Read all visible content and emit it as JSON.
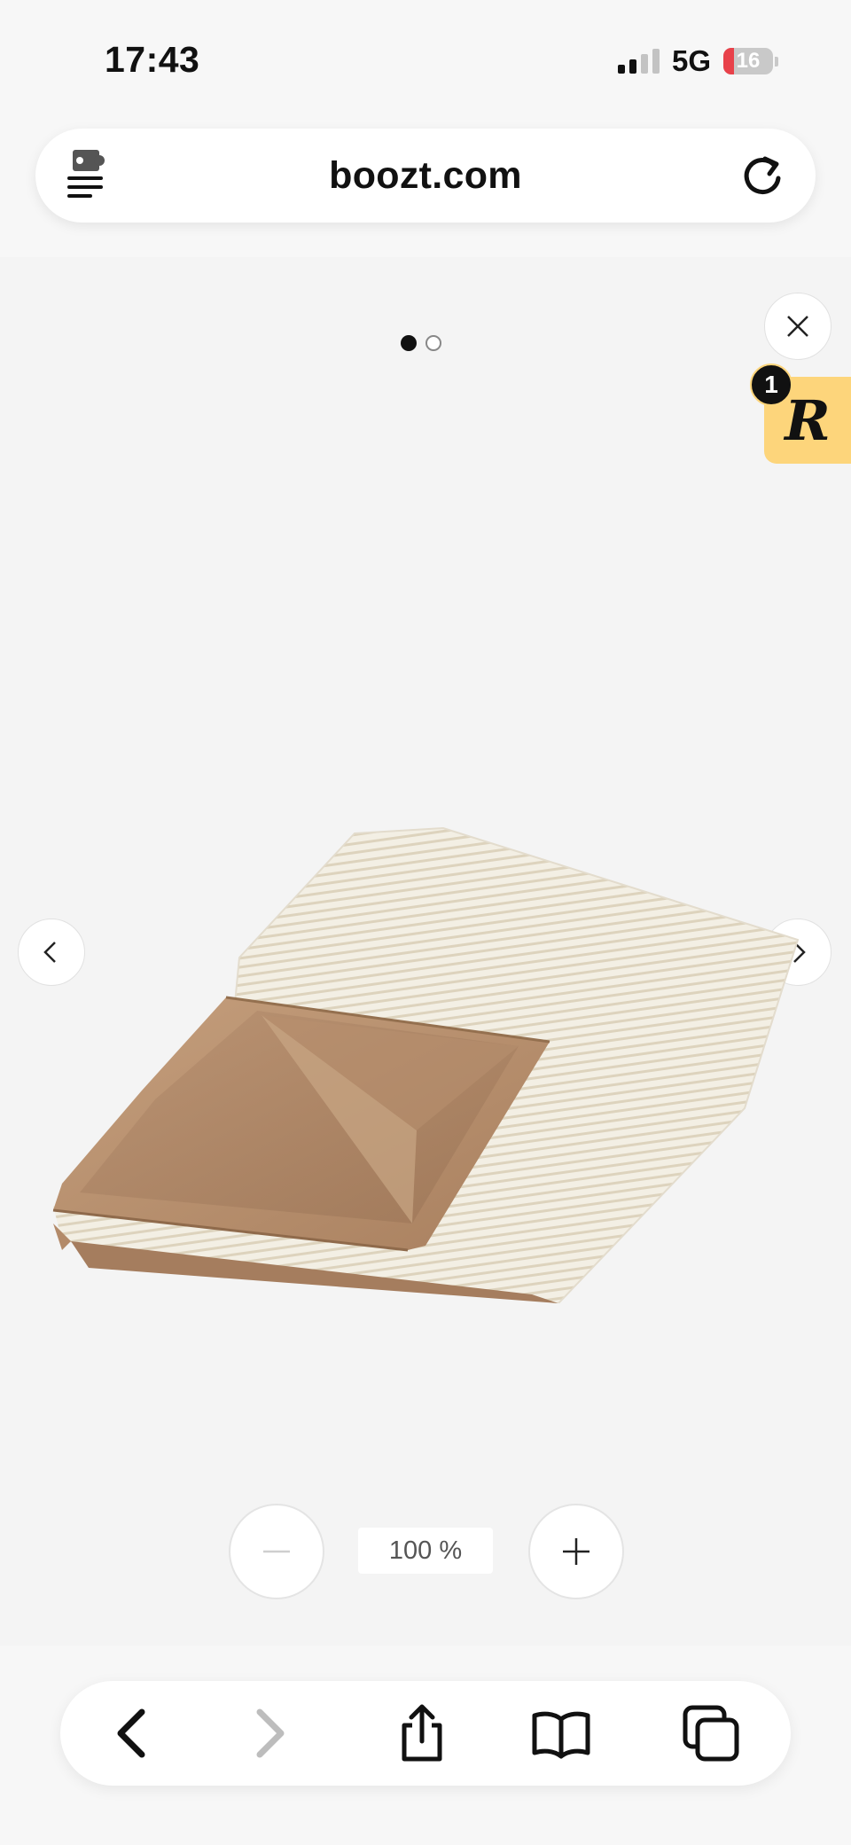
{
  "status_bar": {
    "time": "17:43",
    "network": "5G",
    "battery_level": "16"
  },
  "browser": {
    "url": "boozt.com",
    "left_icon": "page-menu-icon",
    "right_icon": "reload-icon"
  },
  "gallery": {
    "dots_total": 2,
    "active_dot": 1,
    "close_icon": "close-icon",
    "prev_icon": "chevron-left-icon",
    "next_icon": "chevron-right-icon",
    "product_image": "folded-quilt-image"
  },
  "widget": {
    "letter": "R",
    "count": "1",
    "color": "#fdd57b"
  },
  "zoom": {
    "level": "100 %",
    "zoom_out_icon": "minus-icon",
    "zoom_in_icon": "plus-icon"
  },
  "toolbar": {
    "items": [
      "back-icon",
      "forward-icon",
      "share-icon",
      "bookmarks-icon",
      "tabs-icon"
    ]
  }
}
